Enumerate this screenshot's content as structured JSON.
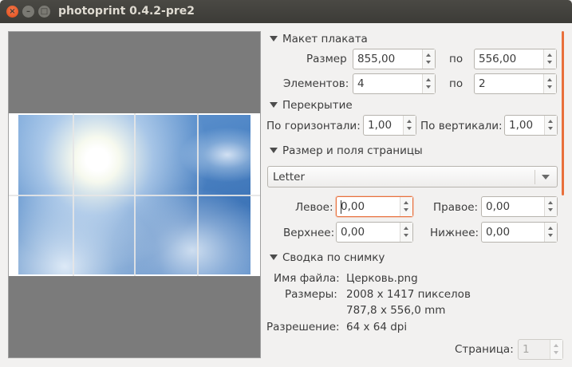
{
  "window": {
    "title": "photoprint 0.4.2-pre2"
  },
  "poster_layout": {
    "header": "Макет плаката",
    "size_label": "Размер",
    "size_w": "855,00",
    "size_h": "556,00",
    "by_label": "по",
    "elements_label": "Элементов:",
    "elements_w": "4",
    "elements_h": "2"
  },
  "overlap": {
    "header": "Перекрытие",
    "horizontal_label": "По горизонтали:",
    "horizontal_value": "1,00",
    "vertical_label": "По вертикали:",
    "vertical_value": "1,00"
  },
  "page": {
    "header": "Размер и поля страницы",
    "paper": "Letter",
    "left_label": "Левое:",
    "left_value": "0,00",
    "right_label": "Правое:",
    "right_value": "0,00",
    "top_label": "Верхнее:",
    "top_value": "0,00",
    "bottom_label": "Нижнее:",
    "bottom_value": "0,00"
  },
  "summary": {
    "header": "Сводка по снимку",
    "filename_label": "Имя файла:",
    "filename": "Церковь.png",
    "dims_label": "Размеры:",
    "dims_px": "2008 x 1417 пикселов",
    "dims_mm": "787,8 x 556,0 mm",
    "res_label": "Разрешение:",
    "res": "64 x 64 dpi"
  },
  "footer": {
    "page_label": "Страница:",
    "page_value": "1"
  },
  "colors": {
    "accent": "#e9703c",
    "titlebar": "#3c3b37",
    "preview_grey": "#7b7b7b"
  }
}
